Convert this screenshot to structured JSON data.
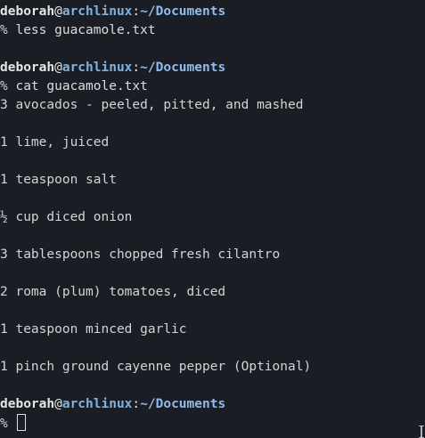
{
  "prompt": {
    "user": "deborah",
    "at": "@",
    "host": "archlinux",
    "colon": ":",
    "path": "~/Documents",
    "symbol": "%"
  },
  "commands": {
    "first": "less guacamole.txt",
    "second": "cat guacamole.txt"
  },
  "output": [
    "3 avocados - peeled, pitted, and mashed",
    "1 lime, juiced",
    "1 teaspoon salt",
    "½ cup diced onion",
    "3 tablespoons chopped fresh cilantro",
    "2 roma (plum) tomatoes, diced",
    "1 teaspoon minced garlic",
    "1 pinch ground cayenne pepper (Optional)"
  ],
  "colors": {
    "background": "#1a1d23",
    "host": "#7fb2e0",
    "path": "#8fbcea"
  }
}
